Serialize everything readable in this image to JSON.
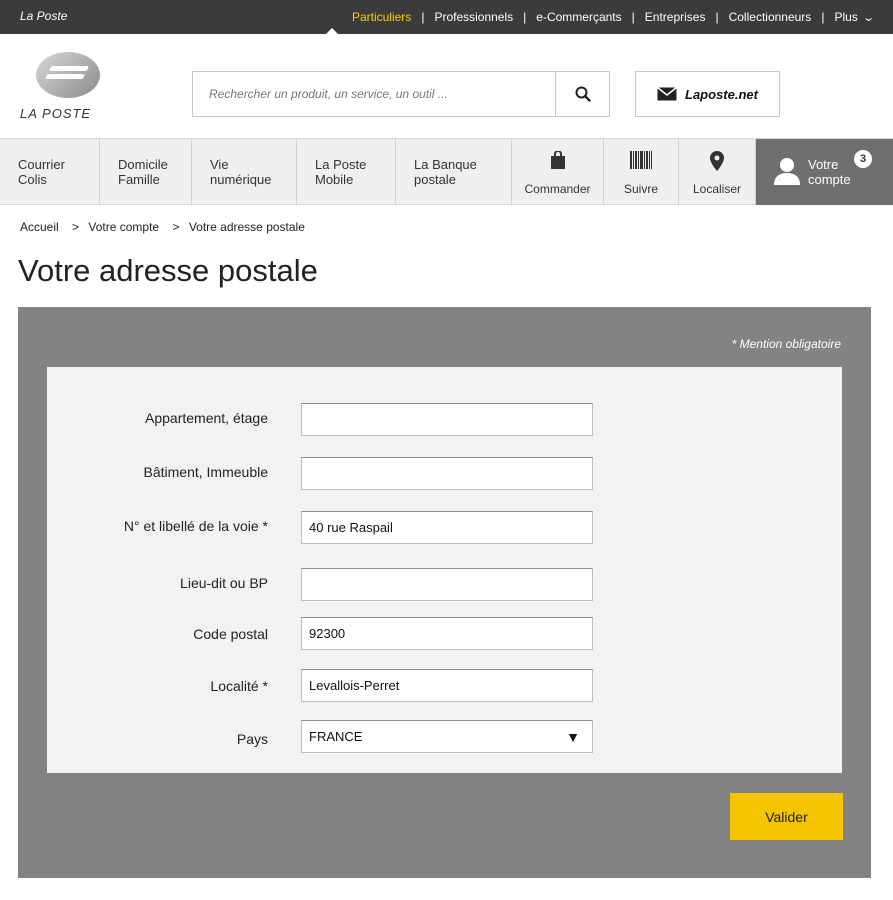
{
  "topbar": {
    "brand": "La Poste",
    "links": [
      "Particuliers",
      "Professionnels",
      "e-Commerçants",
      "Entreprises",
      "Collectionneurs",
      "Plus"
    ],
    "active": "Particuliers"
  },
  "header": {
    "logo_text": "LA POSTE",
    "search_placeholder": "Rechercher un produit, un service, un outil ...",
    "mail_label": "Laposte.net"
  },
  "nav": {
    "items": [
      {
        "line1": "Courrier",
        "line2": "Colis"
      },
      {
        "line1": "Domicile",
        "line2": "Famille"
      },
      {
        "line1": "Vie",
        "line2": "numérique"
      },
      {
        "line1": "La Poste",
        "line2": "Mobile"
      },
      {
        "line1": "La Banque",
        "line2": "postale"
      }
    ],
    "actions": [
      {
        "label": "Commander",
        "icon": "shopping-bag-icon"
      },
      {
        "label": "Suivre",
        "icon": "barcode-icon"
      },
      {
        "label": "Localiser",
        "icon": "location-pin-icon"
      }
    ],
    "account": {
      "line1": "Votre",
      "line2": "compte",
      "badge": "3"
    }
  },
  "breadcrumb": [
    "Accueil",
    ">",
    "Votre compte",
    ">",
    "Votre adresse postale"
  ],
  "page_title": "Votre adresse postale",
  "form": {
    "mention": "* Mention obligatoire",
    "fields": [
      {
        "label": "Appartement, étage",
        "value": ""
      },
      {
        "label": "Bâtiment, Immeuble",
        "value": ""
      },
      {
        "label": "N° et libellé de la voie *",
        "value": "40 rue Raspail"
      },
      {
        "label": "Lieu-dit ou BP",
        "value": ""
      },
      {
        "label": "Code postal",
        "value": "92300"
      },
      {
        "label": "Localité *",
        "value": "Levallois-Perret"
      },
      {
        "label": "Pays",
        "value": "FRANCE"
      }
    ],
    "submit_label": "Valider"
  },
  "colors": {
    "accent": "#f5c400",
    "topbar": "#3b3b3b",
    "panel": "#838383"
  }
}
